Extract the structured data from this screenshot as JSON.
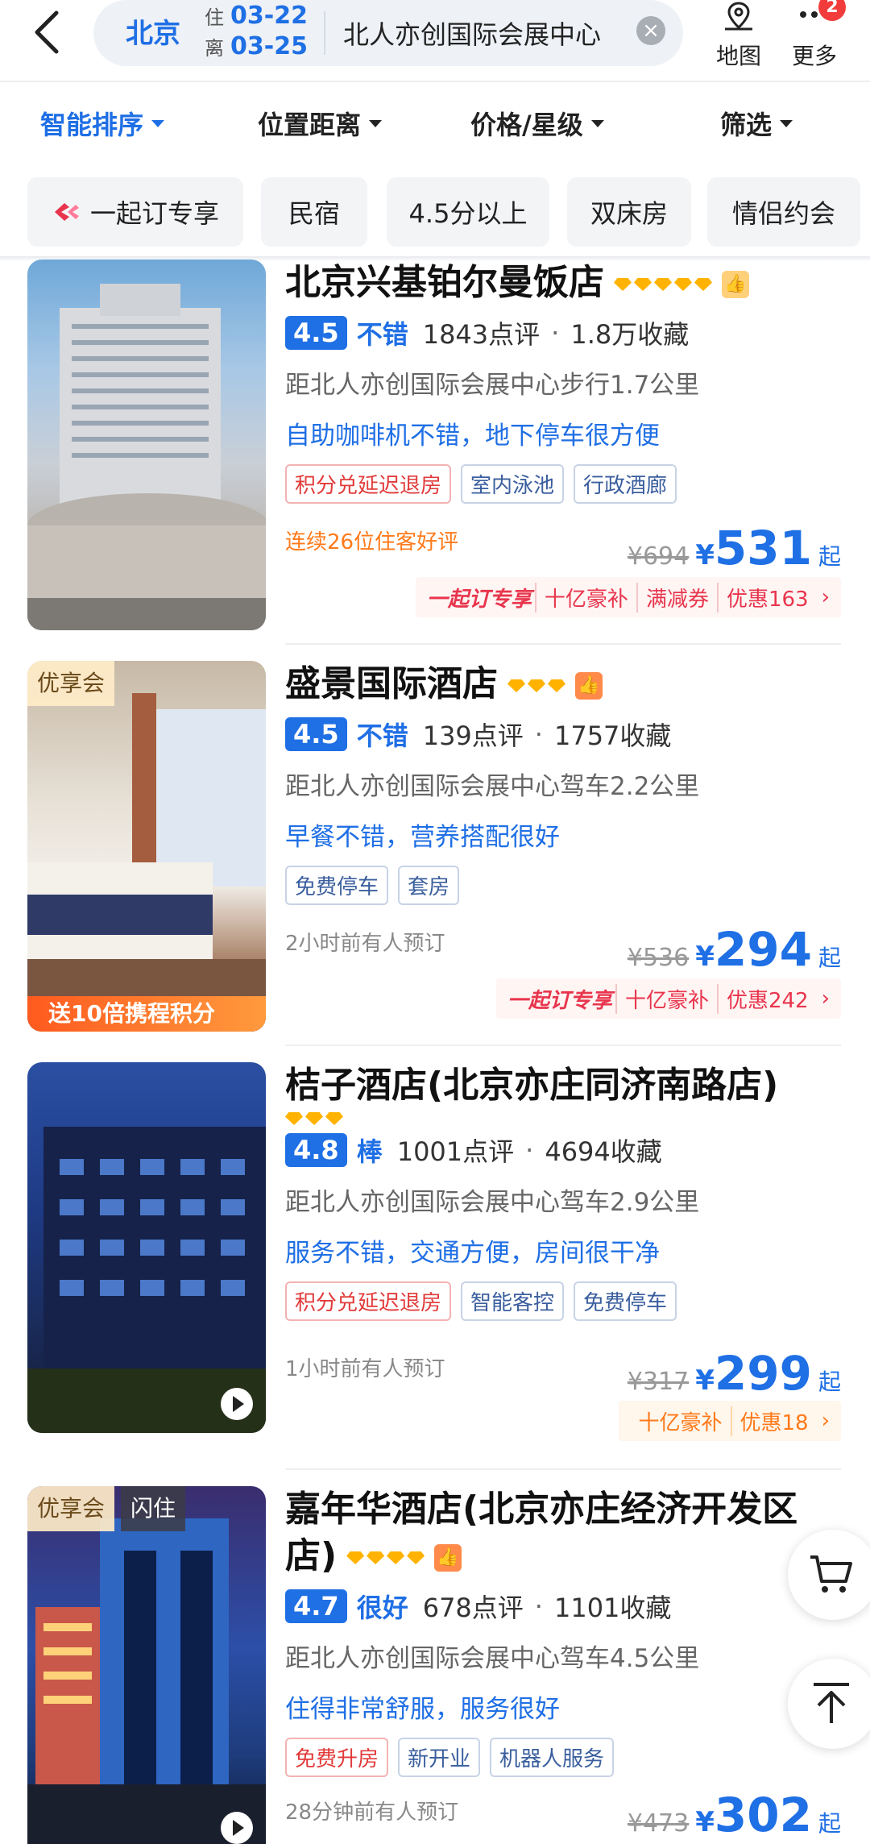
{
  "header": {
    "city": "北京",
    "checkin_label": "住",
    "checkin_date": "03-22",
    "checkout_label": "离",
    "checkout_date": "03-25",
    "keyword": "北人亦创国际会展中心",
    "map_label": "地图",
    "more_label": "更多",
    "more_badge": "2"
  },
  "sort": {
    "items": [
      "智能排序",
      "位置距离",
      "价格/星级",
      "筛选"
    ],
    "active_index": 0
  },
  "chips": [
    "一起订专享",
    "民宿",
    "4.5分以上",
    "双床房",
    "情侣约会"
  ],
  "hotels": [
    {
      "name": "北京兴基铂尔曼饭店",
      "stars": 5,
      "score": "4.5",
      "grade": "不错",
      "reviews": "1843点评",
      "favorites": "1.8万收藏",
      "distance": "距北人亦创国际会展中心步行1.7公里",
      "highlight": "自助咖啡机不错，地下停车很方便",
      "tags": [
        "积分兑延迟退房",
        "室内泳池",
        "行政酒廊"
      ],
      "note": "连续26位住客好评",
      "orig_price": "¥694",
      "price": "531",
      "promo": [
        "一起订专享",
        "十亿豪补",
        "满减券",
        "优惠163"
      ]
    },
    {
      "name": "盛景国际酒店",
      "stars": 3,
      "photo_tag": "优享会",
      "photo_strip": "送10倍携程积分",
      "score": "4.5",
      "grade": "不错",
      "reviews": "139点评",
      "favorites": "1757收藏",
      "distance": "距北人亦创国际会展中心驾车2.2公里",
      "highlight": "早餐不错，营养搭配很好",
      "tags": [
        "免费停车",
        "套房"
      ],
      "note": "2小时前有人预订",
      "orig_price": "¥536",
      "price": "294",
      "promo": [
        "一起订专享",
        "十亿豪补",
        "优惠242"
      ]
    },
    {
      "name": "桔子酒店(北京亦庄同济南路店)",
      "stars": 3,
      "score": "4.8",
      "grade": "棒",
      "reviews": "1001点评",
      "favorites": "4694收藏",
      "distance": "距北人亦创国际会展中心驾车2.9公里",
      "highlight": "服务不错，交通方便，房间很干净",
      "tags": [
        "积分兑延迟退房",
        "智能客控",
        "免费停车"
      ],
      "note": "1小时前有人预订",
      "orig_price": "¥317",
      "price": "299",
      "promo": [
        "十亿豪补",
        "优惠18"
      ]
    },
    {
      "name": "嘉年华酒店(北京亦庄经济开发区店)",
      "name_line1": "嘉年华酒店(北京亦庄经济开发区",
      "name_line2": "店)",
      "stars": 4,
      "photo_tag": "优享会",
      "photo_tag2": "闪住",
      "score": "4.7",
      "grade": "很好",
      "reviews": "678点评",
      "favorites": "1101收藏",
      "distance": "距北人亦创国际会展中心驾车4.5公里",
      "highlight": "住得非常舒服，服务很好",
      "tags": [
        "免费升房",
        "新开业",
        "机器人服务"
      ],
      "note": "28分钟前有人预订",
      "orig_price": "¥473",
      "price": "302"
    }
  ],
  "common": {
    "yen": "¥",
    "qi": "起",
    "dot": "·",
    "chevron": "›"
  },
  "colors": {
    "accent": "#1f6fe5",
    "promo_red": "#e8354d",
    "promo_orange": "#ff7a1a",
    "star": "#ffb300"
  }
}
